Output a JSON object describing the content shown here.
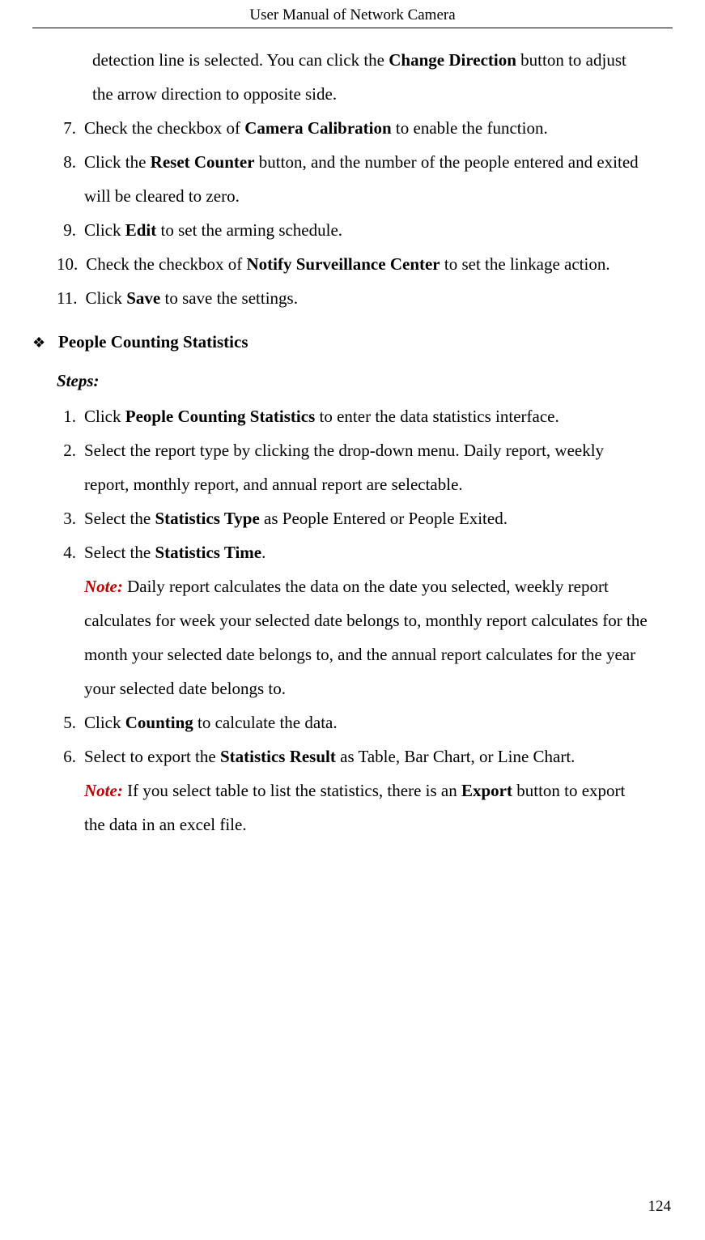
{
  "header": {
    "title": "User Manual of Network Camera"
  },
  "topList": {
    "continuation": {
      "pre": "detection line is selected. You can click the ",
      "bold1": "Change Direction",
      "post": " button to adjust the arrow direction to opposite side."
    },
    "item7": {
      "num": "7.",
      "pre": "Check the checkbox of ",
      "bold1": "Camera Calibration",
      "post": " to enable the function."
    },
    "item8": {
      "num": "8.",
      "pre": "Click the ",
      "bold1": "Reset Counter",
      "post": " button, and the number of the people entered and exited will be cleared to zero."
    },
    "item9": {
      "num": "9.",
      "pre": "Click ",
      "bold1": "Edit",
      "post": " to set the arming schedule."
    },
    "item10": {
      "num": "10.",
      "pre": "Check the checkbox of ",
      "bold1": "Notify Surveillance Center",
      "post": " to set the linkage action."
    },
    "item11": {
      "num": "11.",
      "pre": "Click ",
      "bold1": "Save",
      "post": " to save the settings."
    }
  },
  "section": {
    "bullet": "❖",
    "title": "People Counting Statistics",
    "stepsLabel": "Steps:"
  },
  "stepsList": {
    "item1": {
      "num": "1.",
      "pre": "Click ",
      "bold1": "People Counting Statistics",
      "post": " to enter the data statistics interface."
    },
    "item2": {
      "num": "2.",
      "text": "Select the report type by clicking the drop-down menu. Daily report, weekly report, monthly report, and annual report are selectable."
    },
    "item3": {
      "num": "3.",
      "pre": "Select the ",
      "bold1": "Statistics Type",
      "post": " as People Entered or People Exited."
    },
    "item4": {
      "num": "4.",
      "pre": "Select the ",
      "bold1": "Statistics Time",
      "post": ".",
      "noteLabel": "Note:",
      "noteText": " Daily report calculates the data on the date you selected, weekly report calculates for week your selected date belongs to, monthly report calculates for the month your selected date belongs to, and the annual report calculates for the year your selected date belongs to."
    },
    "item5": {
      "num": "5.",
      "pre": "Click ",
      "bold1": "Counting",
      "post": " to calculate the data."
    },
    "item6": {
      "num": "6.",
      "pre": "Select to export the ",
      "bold1": "Statistics Result",
      "post": " as Table, Bar Chart, or Line Chart.",
      "noteLabel": "Note:",
      "notePre": " If you select table to list the statistics, there is an ",
      "noteBold": "Export",
      "notePost": " button to export the data in an excel file."
    }
  },
  "footer": {
    "pageNum": "124"
  }
}
